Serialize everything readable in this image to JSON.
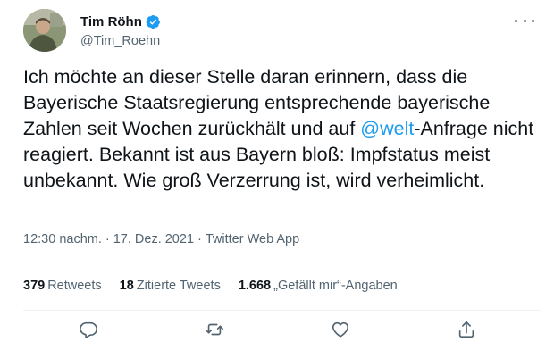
{
  "author": {
    "display_name": "Tim Röhn",
    "handle": "@Tim_Roehn",
    "verified": true,
    "avatar_icon": "avatar-photo"
  },
  "tweet": {
    "text_before_mention": "Ich möchte an dieser Stelle daran erinnern, dass die Bayerische Staatsregierung entsprechende bayerische Zahlen seit Wochen zurückhält und auf ",
    "mention": "@welt",
    "text_after_mention": "-Anfrage nicht reagiert. Bekannt ist aus Bayern bloß: Impfstatus meist unbekannt. Wie groß Verzerrung ist, wird verheimlicht."
  },
  "meta": {
    "time": "12:30 nachm.",
    "separator": "·",
    "date": "17. Dez. 2021",
    "source": "Twitter Web App"
  },
  "stats": {
    "retweets_count": "379",
    "retweets_label": "Retweets",
    "quotes_count": "18",
    "quotes_label": "Zitierte Tweets",
    "likes_count": "1.668",
    "likes_label": "„Gefällt mir“-Angaben"
  },
  "actions": {
    "reply_icon": "reply-icon",
    "retweet_icon": "retweet-icon",
    "like_icon": "heart-icon",
    "share_icon": "share-icon"
  },
  "colors": {
    "accent": "#1d9bf0",
    "secondary_text": "#536471",
    "primary_text": "#0f1419",
    "divider": "#eff3f4"
  }
}
